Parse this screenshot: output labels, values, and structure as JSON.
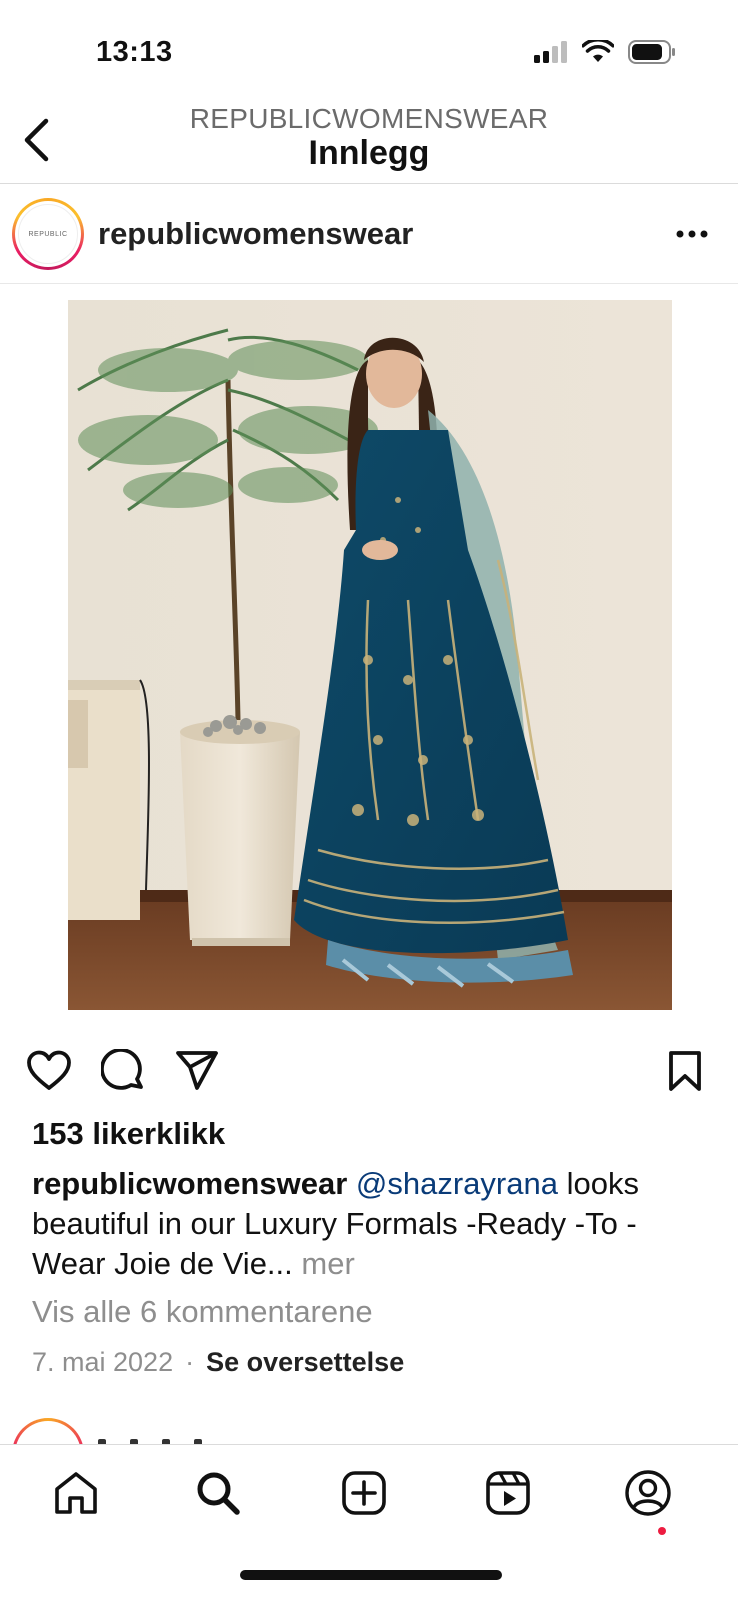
{
  "status_bar": {
    "time": "13:13",
    "icons": [
      "signal-icon",
      "wifi-icon",
      "battery-icon"
    ]
  },
  "header": {
    "account_name": "REPUBLICWOMENSWEAR",
    "title": "Innlegg",
    "back_icon": "chevron-left-icon"
  },
  "post": {
    "username": "republicwomenswear",
    "avatar_text": "REPUBLIC",
    "more_icon": "more-horizontal-icon",
    "image_subject": "post-photo",
    "actions": [
      "heart-icon",
      "comment-icon",
      "share-icon",
      "bookmark-icon"
    ],
    "likes": "153 likerklikk",
    "caption": {
      "username": "republicwomenswear",
      "mention": "@shazrayrana",
      "text": " looks beautiful in our Luxury Formals -Ready -To - Wear Joie de Vie...",
      "more": " mer"
    },
    "view_comments": "Vis alle 6 kommentarene",
    "date": "7. mai 2022",
    "separator": "·",
    "translate": "Se oversettelse"
  },
  "tab_bar": {
    "items": [
      "home-icon",
      "search-icon",
      "new-post-icon",
      "reels-icon",
      "profile-icon"
    ]
  },
  "colors": {
    "accent_link": "#0a3b78",
    "muted_text": "#8e8e8e",
    "notification": "#ed1c40",
    "dress_blue": "#0f4f6e"
  }
}
